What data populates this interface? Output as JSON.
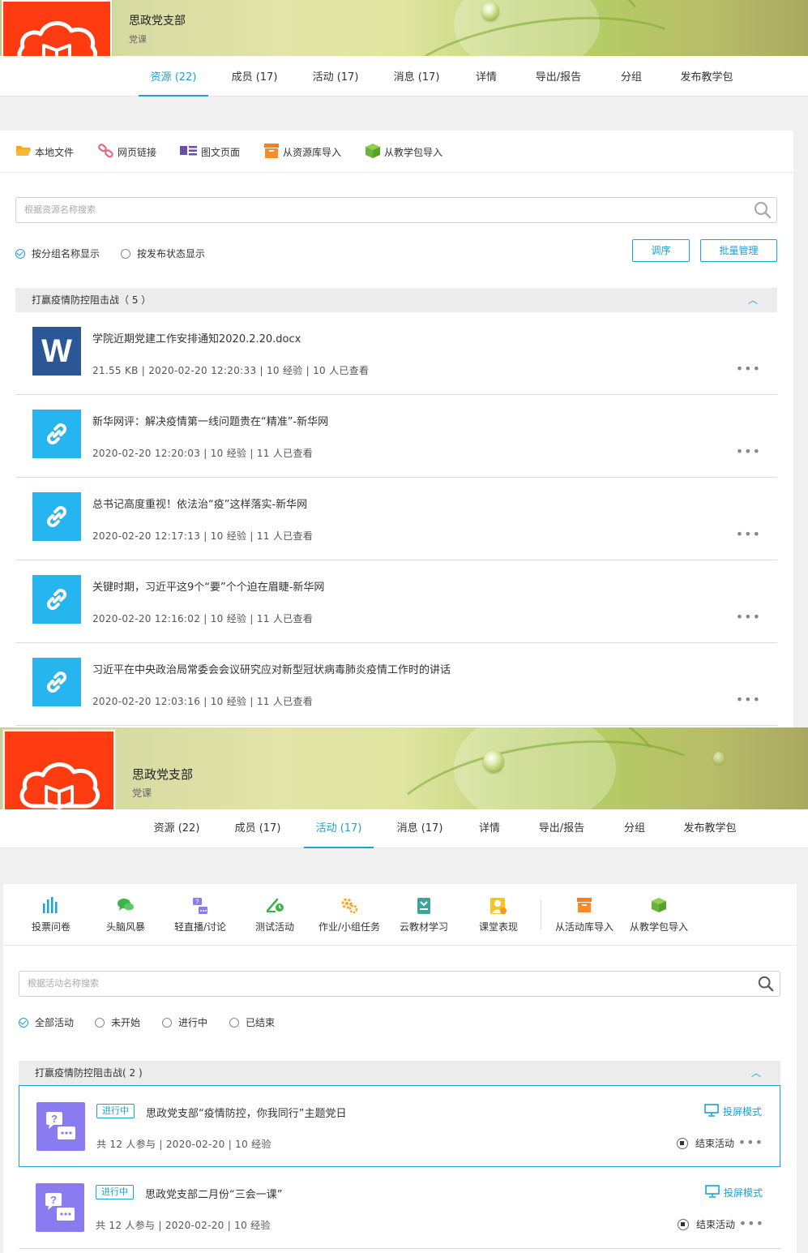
{
  "course": {
    "title": "思政党支部",
    "subtitle": "党课"
  },
  "resources_view": {
    "tabs": [
      {
        "label": "资源 (22)",
        "active": true
      },
      {
        "label": "成员 (17)"
      },
      {
        "label": "活动 (17)"
      },
      {
        "label": "消息 (17)"
      },
      {
        "label": "详情"
      },
      {
        "label": "导出/报告"
      },
      {
        "label": "分组"
      },
      {
        "label": "发布教学包"
      }
    ],
    "toolbar": [
      {
        "label": "本地文件",
        "icon": "folder-icon"
      },
      {
        "label": "网页链接",
        "icon": "link-icon"
      },
      {
        "label": "图文页面",
        "icon": "page-icon"
      },
      {
        "label": "从资源库导入",
        "icon": "archive-icon"
      },
      {
        "label": "从教学包导入",
        "icon": "package-icon"
      }
    ],
    "search_placeholder": "根据资源名称搜索",
    "display_options": [
      {
        "label": "按分组名称显示",
        "checked": true
      },
      {
        "label": "按发布状态显示",
        "checked": false
      }
    ],
    "sort_button": "调序",
    "batch_button": "批量管理",
    "group": {
      "title": "打赢疫情防控阻击战（ 5 ）"
    },
    "items": [
      {
        "type": "word",
        "name": "学院近期党建工作安排通知2020.2.20.docx",
        "meta": "21.55 KB  |  2020-02-20 12:20:33  |  10 经验  |  10 人已查看"
      },
      {
        "type": "link",
        "name": "新华网评：解决疫情第一线问题贵在“精准”-新华网",
        "meta": "2020-02-20 12:20:03  |  10 经验  |  11 人已查看"
      },
      {
        "type": "link",
        "name": "总书记高度重视！依法治“疫”这样落实-新华网",
        "meta": "2020-02-20 12:17:13  |  10 经验  |  11 人已查看"
      },
      {
        "type": "link",
        "name": "关键时期，习近平这9个“要”个个迫在眉睫-新华网",
        "meta": "2020-02-20 12:16:02  |  10 经验  |  11 人已查看"
      },
      {
        "type": "link",
        "name": "习近平在中央政治局常委会会议研究应对新型冠状病毒肺炎疫情工作时的讲话",
        "meta": "2020-02-20 12:03:16  |  10 经验  |  11 人已查看"
      }
    ],
    "more_glyph": "•••"
  },
  "activities_view": {
    "tabs": [
      {
        "label": "资源 (22)"
      },
      {
        "label": "成员 (17)"
      },
      {
        "label": "活动 (17)",
        "active": true
      },
      {
        "label": "消息 (17)"
      },
      {
        "label": "详情"
      },
      {
        "label": "导出/报告"
      },
      {
        "label": "分组"
      },
      {
        "label": "发布教学包"
      }
    ],
    "toolbar": [
      {
        "label": "投票问卷",
        "icon": "bar-chart-icon"
      },
      {
        "label": "头脑风暴",
        "icon": "chat-bubble-icon"
      },
      {
        "label": "轻直播/讨论",
        "icon": "live-icon"
      },
      {
        "label": "测试活动",
        "icon": "test-icon"
      },
      {
        "label": "作业/小组任务",
        "icon": "gear-task-icon"
      },
      {
        "label": "云教材学习",
        "icon": "book-icon"
      },
      {
        "label": "课堂表现",
        "icon": "person-icon"
      },
      {
        "label": "从活动库导入",
        "icon": "archive-icon"
      },
      {
        "label": "从教学包导入",
        "icon": "package-icon"
      }
    ],
    "search_placeholder": "根据活动名称搜索",
    "filters": [
      {
        "label": "全部活动",
        "checked": true
      },
      {
        "label": "未开始",
        "checked": false
      },
      {
        "label": "进行中",
        "checked": false
      },
      {
        "label": "已结束",
        "checked": false
      }
    ],
    "group": {
      "title": "打赢疫情防控阻击战( 2 )"
    },
    "items": [
      {
        "status": "进行中",
        "name": "思政党支部“疫情防控，你我同行”主题党日",
        "meta": "共 12 人参与  |  2020-02-20  |  10 经验",
        "project": "投屏模式",
        "end": "结束活动"
      },
      {
        "status": "进行中",
        "name": "思政党支部二月份“三会一课”",
        "meta": "共 12 人参与  |  2020-02-20  |  10 经验",
        "project": "投屏模式",
        "end": "结束活动"
      }
    ],
    "more_glyph": "•••"
  },
  "colors": {
    "accent": "#1aa3d3",
    "logo": "#ff3c11",
    "word": "#2b5797",
    "link": "#27b5ef",
    "activity": "#8b7bf0"
  }
}
